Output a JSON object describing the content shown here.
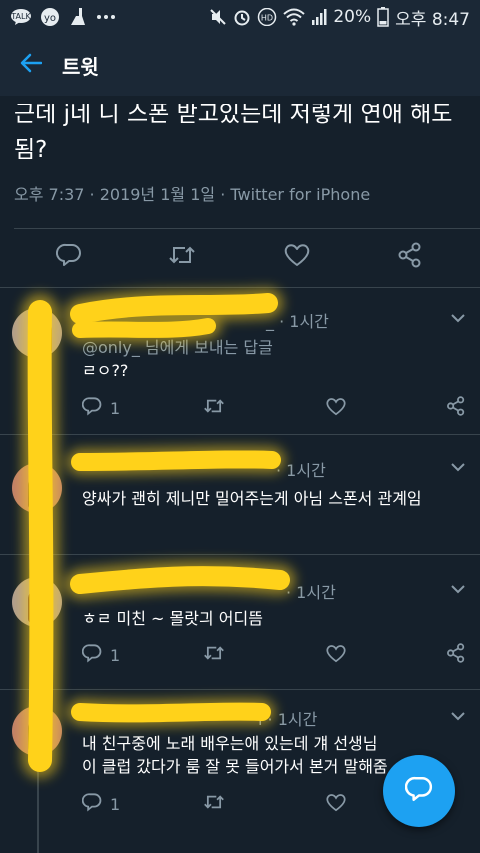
{
  "status_bar": {
    "battery": "20%",
    "time": "오후 8:47",
    "left_icons": [
      "kakaotalk-icon",
      "yo-icon",
      "cleaner-icon",
      "more-dots-icon"
    ],
    "right_icons": [
      "mute-icon",
      "alarm-icon",
      "hd-icon",
      "wifi-icon",
      "signal-icon",
      "battery-icon"
    ]
  },
  "header": {
    "title": "트윗",
    "back_icon": "arrow-left-icon"
  },
  "tweet": {
    "text": "근데 j네 니 스폰 받고있는데 저렇게 연애 해도됨?",
    "meta": "오후 7:37 · 2019년 1월 1일 · Twitter for iPhone",
    "actions": [
      "reply-icon",
      "retweet-icon",
      "like-icon",
      "share-icon"
    ]
  },
  "replies": [
    {
      "time": "· 1시간",
      "handle_fragment": "_",
      "reply_to": "@only_  님에게 보내는 답글",
      "text": "ㄹㅇ??",
      "reply_count": "1"
    },
    {
      "time": "· 1시간",
      "text": "양싸가 괜히 제니만 밀어주는게 아님 스폰서 관계임",
      "reply_count": ""
    },
    {
      "time": "· 1시간",
      "text": "ㅎㄹ 미친 ~ 몰랏긔 어디뜸",
      "reply_count": "1"
    },
    {
      "time": "· 1시간",
      "handle_fragment": "i",
      "text": "내 친구중에 노래 배우는애 있는데 걔 선생님이 클럽 갔다가 룸 잘 못 들어가서 본거 말해줌",
      "reply_count": "1"
    }
  ],
  "fab": {
    "icon": "compose-reply-icon"
  },
  "colors": {
    "background": "#15202b",
    "bar": "#1b2836",
    "accent": "#1da1f2",
    "muted": "#8899a6",
    "scribble": "#ffd21a"
  }
}
